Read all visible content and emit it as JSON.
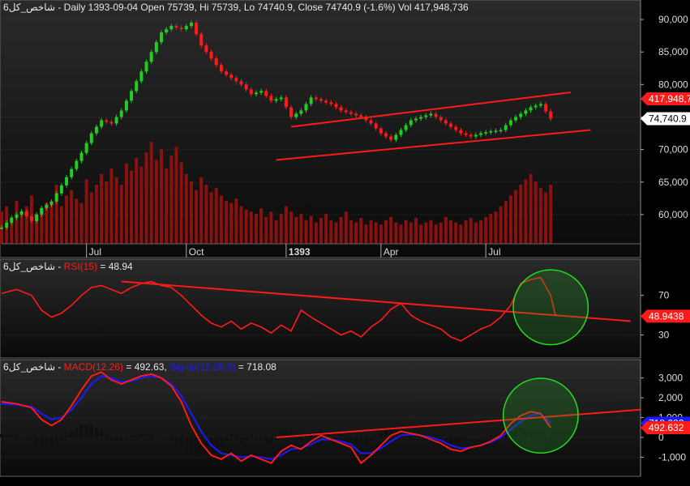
{
  "colors": {
    "background": "#000000",
    "panel_bg_top": "#2a2a2a",
    "panel_bg_bottom": "#0a0a0a",
    "axis_text": "#dcdcdc",
    "grid": "#3a3a3a",
    "candle_up": "#22cc22",
    "candle_down": "#ff1a1a",
    "volume": "#8b1010",
    "trendline": "#ff1a1a",
    "rsi_line": "#ff1a1a",
    "macd_line": "#ff1a1a",
    "signal_line": "#1a1aff",
    "histogram": "#101010",
    "circle": "#22dd22",
    "tag_red": "#ff1a1a",
    "tag_white": "#ffffff",
    "tag_blue": "#1a1aff"
  },
  "chart_data": [
    {
      "type": "candlestick",
      "panel": "price",
      "title": "6شاخص_کل - Daily 1393-09-04 Open 75739, Hi 75739, Lo 74740.9, Close 74740.9 (-1.6%) Vol 417,948,736",
      "ylim": [
        56000,
        92000
      ],
      "yticks": [
        60000,
        65000,
        70000,
        75000,
        80000,
        85000,
        90000
      ],
      "ytick_labels": [
        "60,000",
        "65,000",
        "70,000",
        "75,000",
        "80,000",
        "85,000",
        "90,000"
      ],
      "x_labels": [
        {
          "label": "Jul",
          "index": 17
        },
        {
          "label": "Oct",
          "index": 37
        },
        {
          "label": "1393",
          "index": 57,
          "bold": true
        },
        {
          "label": "Apr",
          "index": 76
        },
        {
          "label": "Jul",
          "index": 97
        }
      ],
      "close_path": [
        [
          0,
          58000
        ],
        [
          2,
          59500
        ],
        [
          4,
          60500
        ],
        [
          6,
          59000
        ],
        [
          8,
          61000
        ],
        [
          10,
          62000
        ],
        [
          12,
          64500
        ],
        [
          14,
          67000
        ],
        [
          16,
          69500
        ],
        [
          18,
          72500
        ],
        [
          20,
          74500
        ],
        [
          22,
          74000
        ],
        [
          24,
          76000
        ],
        [
          26,
          79000
        ],
        [
          28,
          82000
        ],
        [
          30,
          85000
        ],
        [
          32,
          88000
        ],
        [
          34,
          89000
        ],
        [
          36,
          88500
        ],
        [
          38,
          89500
        ],
        [
          40,
          86000
        ],
        [
          42,
          84000
        ],
        [
          44,
          82000
        ],
        [
          46,
          81000
        ],
        [
          48,
          80000
        ],
        [
          50,
          78500
        ],
        [
          52,
          79000
        ],
        [
          54,
          77500
        ],
        [
          56,
          78000
        ],
        [
          58,
          75000
        ],
        [
          60,
          76000
        ],
        [
          62,
          78000
        ],
        [
          64,
          77500
        ],
        [
          66,
          77000
        ],
        [
          68,
          76000
        ],
        [
          70,
          75500
        ],
        [
          72,
          75000
        ],
        [
          74,
          74000
        ],
        [
          76,
          72500
        ],
        [
          78,
          71500
        ],
        [
          80,
          73000
        ],
        [
          82,
          74500
        ],
        [
          84,
          75000
        ],
        [
          86,
          75500
        ],
        [
          88,
          74500
        ],
        [
          90,
          73500
        ],
        [
          92,
          72500
        ],
        [
          94,
          72000
        ],
        [
          96,
          72500
        ],
        [
          98,
          72800
        ],
        [
          100,
          73000
        ],
        [
          102,
          74500
        ],
        [
          104,
          75500
        ],
        [
          106,
          76500
        ],
        [
          108,
          77000
        ],
        [
          110,
          74740.9
        ]
      ],
      "volume": [
        30,
        35,
        25,
        40,
        30,
        35,
        45,
        28,
        32,
        38,
        40,
        55,
        35,
        45,
        50,
        42,
        38,
        60,
        48,
        55,
        65,
        58,
        70,
        62,
        55,
        75,
        68,
        80,
        72,
        85,
        95,
        78,
        88,
        70,
        82,
        90,
        76,
        65,
        58,
        50,
        62,
        55,
        48,
        52,
        45,
        40,
        38,
        42,
        35,
        32,
        30,
        28,
        33,
        25,
        30,
        22,
        28,
        35,
        30,
        25,
        28,
        22,
        26,
        20,
        24,
        28,
        22,
        20,
        25,
        30,
        22,
        20,
        24,
        18,
        22,
        20,
        18,
        22,
        25,
        20,
        18,
        22,
        20,
        24,
        18,
        20,
        22,
        18,
        20,
        25,
        22,
        20,
        18,
        22,
        24,
        20,
        22,
        25,
        28,
        30,
        35,
        40,
        45,
        50,
        55,
        60,
        65,
        58,
        52,
        48,
        55
      ],
      "trendlines": [
        {
          "from": [
            58,
            73500
          ],
          "to": [
            114,
            78800
          ]
        },
        {
          "from": [
            55,
            68400
          ],
          "to": [
            118,
            73000
          ]
        }
      ],
      "tags": [
        {
          "label": "417,948,7",
          "value": 77800,
          "style": "red"
        },
        {
          "label": "74,740.9",
          "value": 74740.9,
          "style": "white"
        }
      ]
    },
    {
      "type": "line",
      "panel": "rsi",
      "title_prefix": "6شاخص_کل - ",
      "title_indicator": "RSI(15)",
      "title_value": " = 48.94",
      "ylim": [
        10,
        100
      ],
      "yticks": [
        30,
        70
      ],
      "ytick_labels": [
        "30",
        "70"
      ],
      "series": [
        {
          "values": [
            [
              0,
              72
            ],
            [
              3,
              76
            ],
            [
              6,
              70
            ],
            [
              8,
              55
            ],
            [
              10,
              48
            ],
            [
              12,
              52
            ],
            [
              14,
              60
            ],
            [
              16,
              70
            ],
            [
              18,
              78
            ],
            [
              20,
              80
            ],
            [
              22,
              76
            ],
            [
              24,
              72
            ],
            [
              26,
              78
            ],
            [
              28,
              82
            ],
            [
              30,
              84
            ],
            [
              32,
              80
            ],
            [
              34,
              78
            ],
            [
              36,
              70
            ],
            [
              38,
              60
            ],
            [
              40,
              50
            ],
            [
              42,
              42
            ],
            [
              44,
              38
            ],
            [
              46,
              44
            ],
            [
              48,
              36
            ],
            [
              50,
              42
            ],
            [
              52,
              38
            ],
            [
              54,
              32
            ],
            [
              56,
              40
            ],
            [
              58,
              34
            ],
            [
              60,
              55
            ],
            [
              62,
              48
            ],
            [
              64,
              42
            ],
            [
              66,
              36
            ],
            [
              68,
              30
            ],
            [
              70,
              34
            ],
            [
              72,
              28
            ],
            [
              74,
              38
            ],
            [
              76,
              45
            ],
            [
              78,
              56
            ],
            [
              80,
              62
            ],
            [
              82,
              50
            ],
            [
              84,
              44
            ],
            [
              86,
              40
            ],
            [
              88,
              36
            ],
            [
              90,
              28
            ],
            [
              92,
              24
            ],
            [
              94,
              30
            ],
            [
              96,
              36
            ],
            [
              98,
              40
            ],
            [
              100,
              48
            ],
            [
              102,
              60
            ],
            [
              104,
              82
            ],
            [
              106,
              86
            ],
            [
              108,
              88
            ],
            [
              110,
              70
            ],
            [
              111,
              48.94
            ]
          ]
        }
      ],
      "trendlines": [
        {
          "from": [
            24,
            84
          ],
          "to": [
            126,
            44
          ]
        }
      ],
      "circle": {
        "cx": 110,
        "cy": 58,
        "r_x": 7.5
      },
      "tags": [
        {
          "label": "48.9438",
          "value": 48.94,
          "style": "red"
        }
      ]
    },
    {
      "type": "line",
      "panel": "macd",
      "title_prefix": "6شاخص_کل - ",
      "title_indicator_1": "MACD(12,26)",
      "title_value_1": " = 492.63, ",
      "title_indicator_2": "Signal(12,26,9)",
      "title_value_2": " = 718.08",
      "ylim": [
        -1800,
        3600
      ],
      "yticks": [
        -1000,
        0,
        1000,
        2000,
        3000
      ],
      "ytick_labels": [
        "-1,000",
        "0",
        "1,000",
        "2,000",
        "3,000"
      ],
      "series": [
        {
          "name": "MACD(12,26)",
          "values": [
            [
              0,
              1800
            ],
            [
              3,
              1700
            ],
            [
              6,
              1500
            ],
            [
              8,
              900
            ],
            [
              10,
              600
            ],
            [
              12,
              900
            ],
            [
              14,
              1600
            ],
            [
              16,
              2400
            ],
            [
              18,
              3100
            ],
            [
              20,
              3300
            ],
            [
              22,
              2900
            ],
            [
              24,
              2700
            ],
            [
              26,
              2900
            ],
            [
              28,
              3100
            ],
            [
              30,
              3200
            ],
            [
              32,
              3000
            ],
            [
              34,
              2600
            ],
            [
              36,
              1800
            ],
            [
              38,
              600
            ],
            [
              40,
              -300
            ],
            [
              42,
              -900
            ],
            [
              44,
              -1100
            ],
            [
              46,
              -800
            ],
            [
              48,
              -1200
            ],
            [
              50,
              -900
            ],
            [
              52,
              -1100
            ],
            [
              54,
              -1300
            ],
            [
              56,
              -700
            ],
            [
              58,
              -400
            ],
            [
              60,
              -600
            ],
            [
              62,
              -200
            ],
            [
              64,
              100
            ],
            [
              66,
              -100
            ],
            [
              68,
              -300
            ],
            [
              70,
              -500
            ],
            [
              72,
              -1300
            ],
            [
              74,
              -900
            ],
            [
              76,
              -400
            ],
            [
              78,
              100
            ],
            [
              80,
              300
            ],
            [
              82,
              200
            ],
            [
              84,
              100
            ],
            [
              86,
              -100
            ],
            [
              88,
              -300
            ],
            [
              90,
              -600
            ],
            [
              92,
              -700
            ],
            [
              94,
              -500
            ],
            [
              96,
              -400
            ],
            [
              98,
              -200
            ],
            [
              100,
              100
            ],
            [
              102,
              700
            ],
            [
              104,
              1100
            ],
            [
              106,
              1300
            ],
            [
              108,
              1200
            ],
            [
              110,
              492.63
            ]
          ]
        },
        {
          "name": "Signal(12,26,9)",
          "values": [
            [
              0,
              1700
            ],
            [
              3,
              1650
            ],
            [
              6,
              1550
            ],
            [
              8,
              1200
            ],
            [
              10,
              900
            ],
            [
              12,
              1000
            ],
            [
              14,
              1400
            ],
            [
              16,
              2000
            ],
            [
              18,
              2700
            ],
            [
              20,
              3100
            ],
            [
              22,
              3000
            ],
            [
              24,
              2800
            ],
            [
              26,
              2850
            ],
            [
              28,
              3000
            ],
            [
              30,
              3100
            ],
            [
              32,
              3000
            ],
            [
              34,
              2700
            ],
            [
              36,
              2100
            ],
            [
              38,
              1200
            ],
            [
              40,
              300
            ],
            [
              42,
              -400
            ],
            [
              44,
              -800
            ],
            [
              46,
              -900
            ],
            [
              48,
              -1000
            ],
            [
              50,
              -950
            ],
            [
              52,
              -1000
            ],
            [
              54,
              -1100
            ],
            [
              56,
              -900
            ],
            [
              58,
              -600
            ],
            [
              60,
              -550
            ],
            [
              62,
              -350
            ],
            [
              64,
              -100
            ],
            [
              66,
              -100
            ],
            [
              68,
              -200
            ],
            [
              70,
              -350
            ],
            [
              72,
              -800
            ],
            [
              74,
              -800
            ],
            [
              76,
              -550
            ],
            [
              78,
              -200
            ],
            [
              80,
              100
            ],
            [
              82,
              150
            ],
            [
              84,
              100
            ],
            [
              86,
              0
            ],
            [
              88,
              -150
            ],
            [
              90,
              -400
            ],
            [
              92,
              -550
            ],
            [
              94,
              -500
            ],
            [
              96,
              -400
            ],
            [
              98,
              -250
            ],
            [
              100,
              0
            ],
            [
              102,
              400
            ],
            [
              104,
              800
            ],
            [
              106,
              1100
            ],
            [
              108,
              1200
            ],
            [
              110,
              718.08
            ]
          ]
        }
      ],
      "trendlines": [
        {
          "from": [
            55,
            0
          ],
          "to": [
            128,
            1400
          ]
        }
      ],
      "circle": {
        "cx": 108,
        "cy": 1100,
        "r_x": 7.5
      },
      "tags": [
        {
          "label": "718.082",
          "value": 718.08,
          "style": "blue"
        },
        {
          "label": "492.632",
          "value": 492.63,
          "style": "red"
        }
      ]
    }
  ]
}
